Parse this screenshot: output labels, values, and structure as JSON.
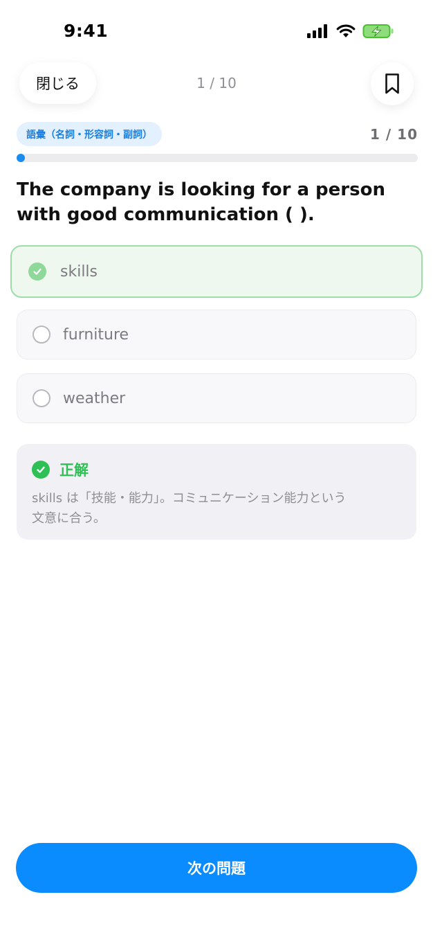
{
  "status_bar": {
    "time": "9:41",
    "icons": [
      "cellular-signal-icon",
      "wifi-icon",
      "battery-charging-icon"
    ]
  },
  "header": {
    "close_label": "閉じる",
    "counter": "1 / 10",
    "bookmark_icon": "bookmark-icon"
  },
  "category": {
    "label": "語彙（名詞・形容詞・副詞）",
    "counter": "1 / 10"
  },
  "progress": {
    "current": 1,
    "total": 10,
    "fraction": 0.02
  },
  "question": {
    "line1": "The company is looking for a person",
    "line2": "with good communication ( )."
  },
  "options": [
    {
      "label": "skills",
      "state": "selected-correct"
    },
    {
      "label": "furniture",
      "state": "unselected"
    },
    {
      "label": "weather",
      "state": "unselected"
    }
  ],
  "explanation": {
    "title": "正解",
    "line1": "skills は「技能・能力」。コミュニケーション能力という",
    "line2": "文意に合う。"
  },
  "next_button": {
    "label": "次の問題"
  },
  "colors": {
    "accent": "#0a8cff",
    "correct": "#2ec055",
    "selected_border": "#9edca9",
    "selected_bg": "#eef8ee",
    "badge_bg": "#e3f0fd",
    "badge_text": "#1a7fe0"
  }
}
